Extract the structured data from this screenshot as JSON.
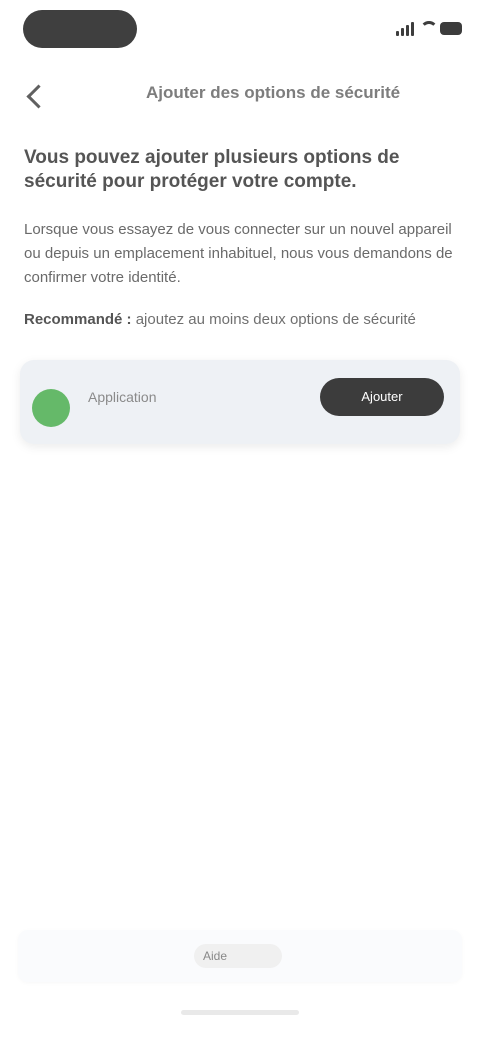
{
  "status_bar": {
    "pill_icon": "time-pill-icon",
    "signal_icon": "signal-icon",
    "wifi_icon": "wifi-icon",
    "battery_icon": "battery-icon"
  },
  "header": {
    "back_icon": "chevron-left-icon",
    "title": "Ajouter des options de sécurité"
  },
  "content": {
    "intro": "Vous pouvez ajouter plusieurs options de sécurité pour protéger votre compte.",
    "body": "Lorsque vous essayez de vous connecter sur un nouvel appareil ou depuis un emplacement inhabituel, nous vous demandons de confirmer votre identité.",
    "note_bold": "Recommandé :",
    "note_rest": "ajoutez au moins deux options de sécurité"
  },
  "card": {
    "icon": "shield-icon",
    "label": "Application",
    "button": "Ajouter"
  },
  "bottom_bar": {
    "label": "Aide"
  },
  "colors": {
    "background": "#ffffff",
    "card_background": "#eef1f5",
    "button_background": "#3c3c3c",
    "accent_green": "#4caf50"
  }
}
